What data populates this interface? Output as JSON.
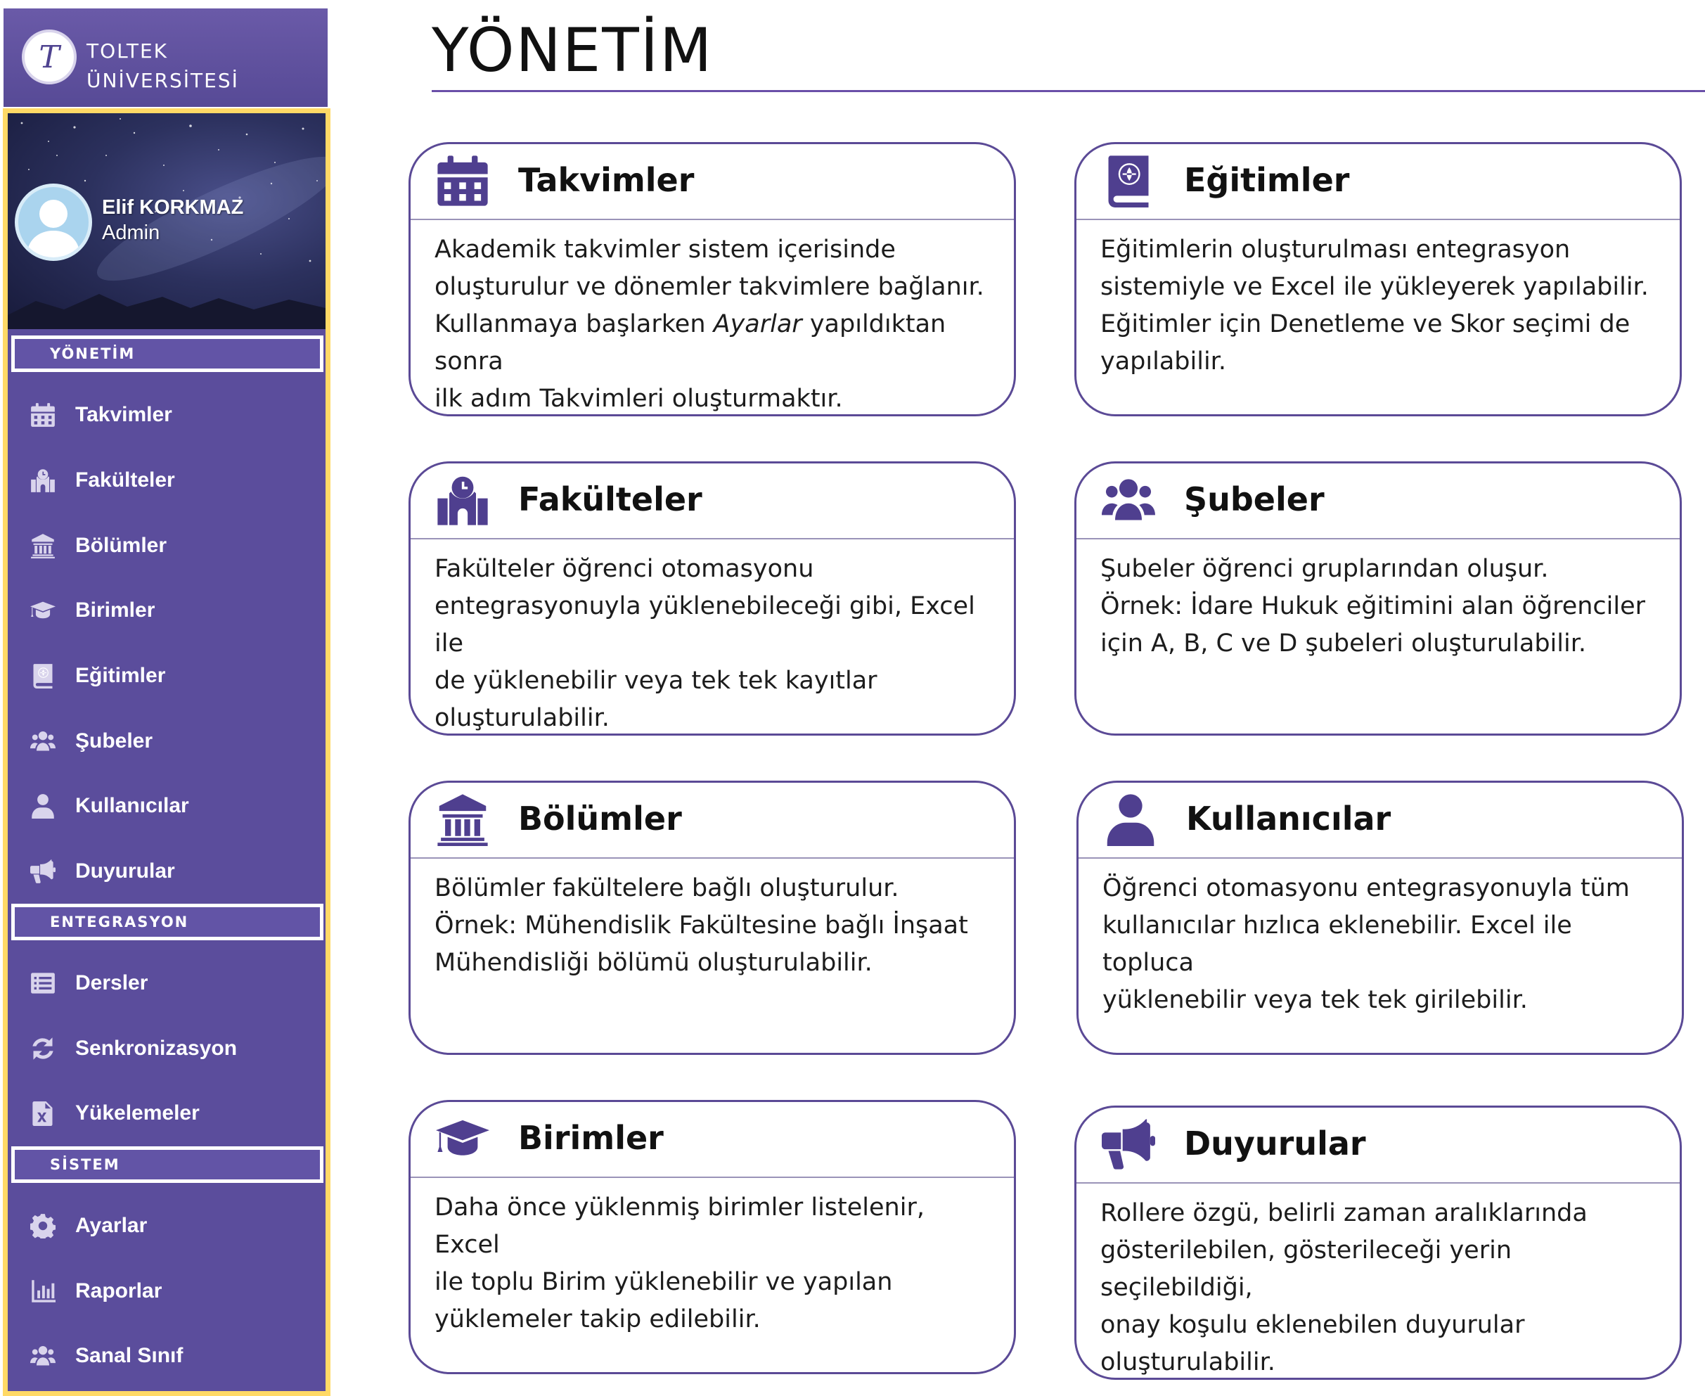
{
  "brand": {
    "logo_letter": "T",
    "line1": "TOLTEK",
    "line2": "ÜNİVERSİTESİ"
  },
  "user": {
    "name": "Elif KORKMAZ",
    "role": "Admin"
  },
  "sidebar": {
    "sections": [
      {
        "label": "YÖNETİM",
        "items": [
          {
            "label": "Takvimler",
            "icon": "calendar-icon"
          },
          {
            "label": "Fakülteler",
            "icon": "school-icon"
          },
          {
            "label": "Bölümler",
            "icon": "landmark-icon"
          },
          {
            "label": "Birimler",
            "icon": "graduation-cap-icon"
          },
          {
            "label": "Eğitimler",
            "icon": "atlas-icon"
          },
          {
            "label": "Şubeler",
            "icon": "users-icon"
          },
          {
            "label": "Kullanıcılar",
            "icon": "user-icon"
          },
          {
            "label": "Duyurular",
            "icon": "bullhorn-icon"
          }
        ]
      },
      {
        "label": "ENTEGRASYON",
        "items": [
          {
            "label": "Dersler",
            "icon": "list-icon"
          },
          {
            "label": "Senkronizasyon",
            "icon": "sync-icon"
          },
          {
            "label": "Yükelemeler",
            "icon": "excel-file-icon"
          }
        ]
      },
      {
        "label": "SİSTEM",
        "items": [
          {
            "label": "Ayarlar",
            "icon": "gear-icon"
          },
          {
            "label": "Raporlar",
            "icon": "bar-chart-icon"
          },
          {
            "label": "Sanal Sınıf",
            "icon": "users-icon"
          }
        ]
      }
    ]
  },
  "main": {
    "title": "YÖNETİM",
    "cards": [
      {
        "title": "Takvimler",
        "icon": "calendar-icon",
        "lines": [
          "Akademik takvimler sistem içerisinde",
          "oluşturulur ve dönemler takvimlere bağlanır.",
          "Kullanmaya başlarken",
          "Ayarlar",
          "yapıldıktan sonra",
          "ilk adım Takvimleri oluşturmaktır."
        ]
      },
      {
        "title": "Eğitimler",
        "icon": "atlas-icon",
        "lines": [
          "Eğitimlerin oluşturulması entegrasyon",
          "sistemiyle ve Excel ile yükleyerek yapılabilir.",
          "Eğitimler için Denetleme ve Skor seçimi de",
          "yapılabilir."
        ]
      },
      {
        "title": "Fakülteler",
        "icon": "school-icon",
        "lines": [
          "Fakülteler öğrenci otomasyonu",
          "entegrasyonuyla yüklenebileceği gibi, Excel ile",
          "de yüklenebilir veya tek tek kayıtlar",
          "oluşturulabilir."
        ]
      },
      {
        "title": "Şubeler",
        "icon": "users-icon",
        "lines": [
          "Şubeler öğrenci gruplarından oluşur.",
          "Örnek: İdare Hukuk eğitimini alan öğrenciler",
          "için A, B, C ve D şubeleri oluşturulabilir."
        ]
      },
      {
        "title": "Bölümler",
        "icon": "landmark-icon",
        "lines": [
          "Bölümler fakültelere bağlı oluşturulur.",
          "Örnek: Mühendislik Fakültesine bağlı İnşaat",
          "Mühendisliği bölümü oluşturulabilir."
        ]
      },
      {
        "title": "Kullanıcılar",
        "icon": "user-icon",
        "lines": [
          "Öğrenci otomasyonu entegrasyonuyla tüm",
          "kullanıcılar hızlıca eklenebilir. Excel ile topluca",
          "yüklenebilir veya tek tek girilebilir."
        ]
      },
      {
        "title": "Birimler",
        "icon": "graduation-cap-icon",
        "lines": [
          "Daha önce yüklenmiş birimler listelenir, Excel",
          "ile toplu Birim yüklenebilir ve yapılan",
          "yüklemeler  takip edilebilir."
        ]
      },
      {
        "title": "Duyurular",
        "icon": "bullhorn-icon",
        "lines": [
          "Rollere özgü, belirli zaman aralıklarında",
          "gösterilebilen, gösterileceği yerin seçilebildiği,",
          "onay koşulu eklenebilen duyurular",
          "oluşturulabilir."
        ]
      }
    ]
  }
}
